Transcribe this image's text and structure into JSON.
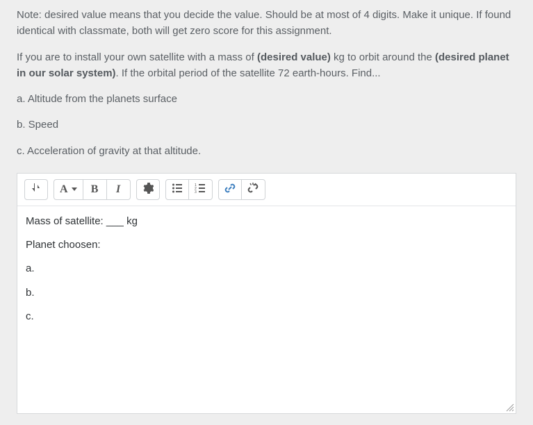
{
  "question": {
    "note": "Note: desired value means that you decide the value. Should be at most of 4 digits. Make it unique. If found identical with classmate, both will get zero score for this assignment.",
    "sentence_parts": {
      "p1": "If you are to install your own satellite with a mass of ",
      "bold1": "(desired value)",
      "p2": " kg to orbit around the ",
      "bold2": "(desired planet in our solar system)",
      "p3": ". If the orbital period of the satellite 72 earth-hours. Find..."
    },
    "item_a": "a. Altitude from the planets surface",
    "item_b": "b. Speed",
    "item_c": "c. Acceleration of gravity at that altitude."
  },
  "toolbar": {
    "font_label": "A",
    "bold_label": "B",
    "italic_label": "I"
  },
  "editor": {
    "line_mass": "Mass of satellite: ___ kg",
    "line_planet": "Planet choosen:",
    "line_a": "a.",
    "line_b": "b.",
    "line_c": "c."
  }
}
